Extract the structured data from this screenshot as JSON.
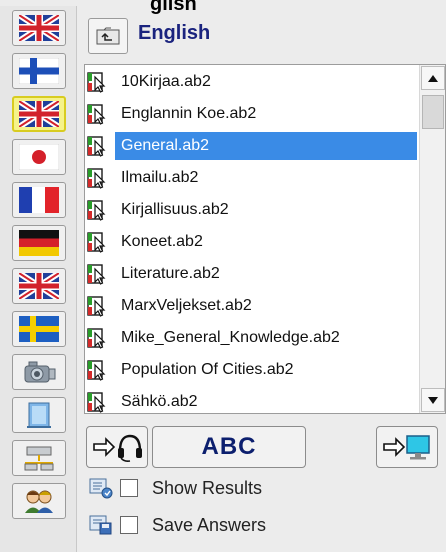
{
  "header": {
    "title_fragment": "glish",
    "language_title": "English"
  },
  "sidebar": {
    "items": [
      {
        "name": "flag-uk-icon"
      },
      {
        "name": "flag-finland-icon"
      },
      {
        "name": "flag-uk-icon",
        "selected": true
      },
      {
        "name": "flag-japan-icon"
      },
      {
        "name": "flag-france-icon"
      },
      {
        "name": "flag-germany-icon"
      },
      {
        "name": "flag-uk-icon"
      },
      {
        "name": "flag-sweden-icon"
      },
      {
        "name": "camera-icon"
      },
      {
        "name": "notepad-icon"
      },
      {
        "name": "network-icon"
      },
      {
        "name": "users-icon"
      }
    ]
  },
  "file_list": {
    "selected_index": 2,
    "items": [
      "10Kirjaa.ab2",
      "Englannin Koe.ab2",
      "General.ab2",
      "Ilmailu.ab2",
      "Kirjallisuus.ab2",
      "Koneet.ab2",
      "Literature.ab2",
      "MarxVeljekset.ab2",
      "Mike_General_Knowledge.ab2",
      "Population Of Cities.ab2",
      "Sähkö.ab2"
    ]
  },
  "toolbar": {
    "abc_label": "ABC",
    "show_results_label": "Show Results",
    "save_answers_label": "Save Answers",
    "show_results_checked": false,
    "save_answers_checked": false
  },
  "colors": {
    "selection": "#3a8be6",
    "title_text": "#1a237e",
    "abc_text": "#0c1f6e",
    "active_side_button": "#f6f38a"
  }
}
